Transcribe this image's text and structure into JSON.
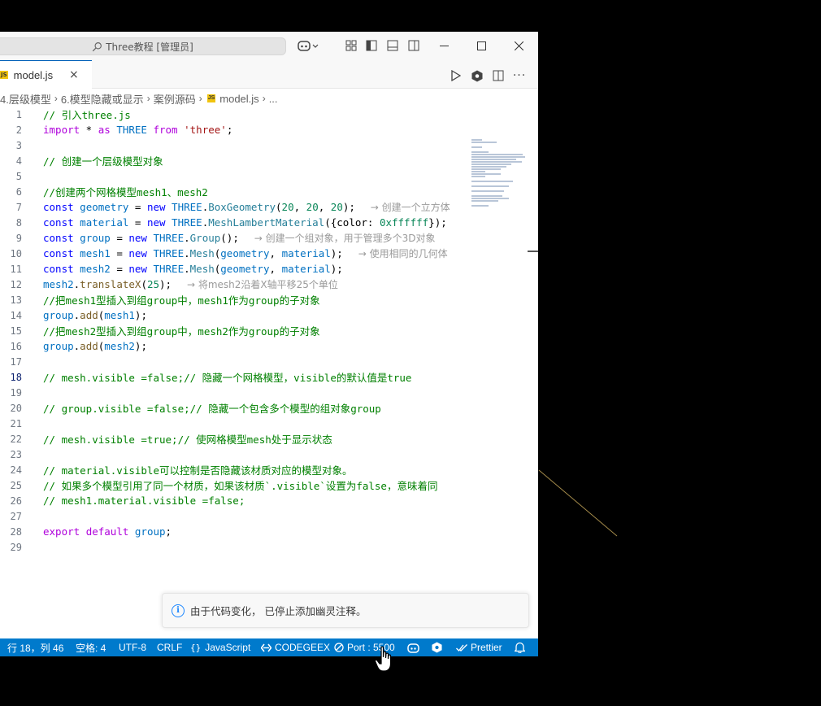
{
  "window": {
    "search_title": "Three教程 [管理员]"
  },
  "tab": {
    "badge": "JS",
    "label": "model.js",
    "close": "×"
  },
  "breadcrumb": {
    "items": [
      "4.层级模型",
      "6.模型隐藏或显示",
      "案例源码",
      "model.js",
      "..."
    ],
    "file_badge": "JS"
  },
  "editor": {
    "current_line": 18,
    "lines": [
      {
        "n": "1",
        "tokens": [
          {
            "t": "// 引入three.js",
            "c": "cmt"
          }
        ]
      },
      {
        "n": "2",
        "tokens": [
          {
            "t": "import",
            "c": "ctl"
          },
          {
            "t": " * ",
            "c": "plain"
          },
          {
            "t": "as",
            "c": "ctl"
          },
          {
            "t": " THREE ",
            "c": "var"
          },
          {
            "t": "from",
            "c": "ctl"
          },
          {
            "t": " ",
            "c": "plain"
          },
          {
            "t": "'three'",
            "c": "str"
          },
          {
            "t": ";",
            "c": "plain"
          }
        ]
      },
      {
        "n": "3",
        "tokens": []
      },
      {
        "n": "4",
        "tokens": [
          {
            "t": "// 创建一个层级模型对象",
            "c": "cmt"
          }
        ]
      },
      {
        "n": "5",
        "tokens": []
      },
      {
        "n": "6",
        "tokens": [
          {
            "t": "//创建两个网格模型mesh1、mesh2",
            "c": "cmt"
          }
        ]
      },
      {
        "n": "7",
        "tokens": [
          {
            "t": "const",
            "c": "kw"
          },
          {
            "t": " geometry",
            "c": "var"
          },
          {
            "t": " = ",
            "c": "plain"
          },
          {
            "t": "new",
            "c": "kw"
          },
          {
            "t": " THREE",
            "c": "var"
          },
          {
            "t": ".",
            "c": "plain"
          },
          {
            "t": "BoxGeometry",
            "c": "cls"
          },
          {
            "t": "(",
            "c": "plain"
          },
          {
            "t": "20",
            "c": "num"
          },
          {
            "t": ", ",
            "c": "plain"
          },
          {
            "t": "20",
            "c": "num"
          },
          {
            "t": ", ",
            "c": "plain"
          },
          {
            "t": "20",
            "c": "num"
          },
          {
            "t": ");  ",
            "c": "plain"
          },
          {
            "t": " → 创建一个立方体",
            "c": "ghost"
          }
        ]
      },
      {
        "n": "8",
        "tokens": [
          {
            "t": "const",
            "c": "kw"
          },
          {
            "t": " material",
            "c": "var"
          },
          {
            "t": " = ",
            "c": "plain"
          },
          {
            "t": "new",
            "c": "kw"
          },
          {
            "t": " THREE",
            "c": "var"
          },
          {
            "t": ".",
            "c": "plain"
          },
          {
            "t": "MeshLambertMaterial",
            "c": "cls"
          },
          {
            "t": "({color: ",
            "c": "plain"
          },
          {
            "t": "0xffffff",
            "c": "num"
          },
          {
            "t": "});",
            "c": "plain"
          }
        ]
      },
      {
        "n": "9",
        "tokens": [
          {
            "t": "const",
            "c": "kw"
          },
          {
            "t": " group",
            "c": "var"
          },
          {
            "t": " = ",
            "c": "plain"
          },
          {
            "t": "new",
            "c": "kw"
          },
          {
            "t": " THREE",
            "c": "var"
          },
          {
            "t": ".",
            "c": "plain"
          },
          {
            "t": "Group",
            "c": "cls"
          },
          {
            "t": "();  ",
            "c": "plain"
          },
          {
            "t": " → 创建一个组对象，用于管理多个3D对象",
            "c": "ghost"
          }
        ]
      },
      {
        "n": "10",
        "tokens": [
          {
            "t": "const",
            "c": "kw"
          },
          {
            "t": " mesh1",
            "c": "var"
          },
          {
            "t": " = ",
            "c": "plain"
          },
          {
            "t": "new",
            "c": "kw"
          },
          {
            "t": " THREE",
            "c": "var"
          },
          {
            "t": ".",
            "c": "plain"
          },
          {
            "t": "Mesh",
            "c": "cls"
          },
          {
            "t": "(",
            "c": "plain"
          },
          {
            "t": "geometry",
            "c": "var"
          },
          {
            "t": ", ",
            "c": "plain"
          },
          {
            "t": "material",
            "c": "var"
          },
          {
            "t": ");  ",
            "c": "plain"
          },
          {
            "t": " → 使用相同的几何体",
            "c": "ghost"
          }
        ]
      },
      {
        "n": "11",
        "tokens": [
          {
            "t": "const",
            "c": "kw"
          },
          {
            "t": " mesh2",
            "c": "var"
          },
          {
            "t": " = ",
            "c": "plain"
          },
          {
            "t": "new",
            "c": "kw"
          },
          {
            "t": " THREE",
            "c": "var"
          },
          {
            "t": ".",
            "c": "plain"
          },
          {
            "t": "Mesh",
            "c": "cls"
          },
          {
            "t": "(",
            "c": "plain"
          },
          {
            "t": "geometry",
            "c": "var"
          },
          {
            "t": ", ",
            "c": "plain"
          },
          {
            "t": "material",
            "c": "var"
          },
          {
            "t": ");",
            "c": "plain"
          }
        ]
      },
      {
        "n": "12",
        "tokens": [
          {
            "t": "mesh2",
            "c": "var"
          },
          {
            "t": ".",
            "c": "plain"
          },
          {
            "t": "translateX",
            "c": "fn"
          },
          {
            "t": "(",
            "c": "plain"
          },
          {
            "t": "25",
            "c": "num"
          },
          {
            "t": ");  ",
            "c": "plain"
          },
          {
            "t": " → 将mesh2沿着X轴平移25个单位",
            "c": "ghost"
          }
        ]
      },
      {
        "n": "13",
        "tokens": [
          {
            "t": "//把mesh1型插入到组group中，mesh1作为group的子对象",
            "c": "cmt"
          }
        ]
      },
      {
        "n": "14",
        "tokens": [
          {
            "t": "group",
            "c": "var"
          },
          {
            "t": ".",
            "c": "plain"
          },
          {
            "t": "add",
            "c": "fn"
          },
          {
            "t": "(",
            "c": "plain"
          },
          {
            "t": "mesh1",
            "c": "var"
          },
          {
            "t": ");",
            "c": "plain"
          }
        ]
      },
      {
        "n": "15",
        "tokens": [
          {
            "t": "//把mesh2型插入到组group中，mesh2作为group的子对象",
            "c": "cmt"
          }
        ]
      },
      {
        "n": "16",
        "tokens": [
          {
            "t": "group",
            "c": "var"
          },
          {
            "t": ".",
            "c": "plain"
          },
          {
            "t": "add",
            "c": "fn"
          },
          {
            "t": "(",
            "c": "plain"
          },
          {
            "t": "mesh2",
            "c": "var"
          },
          {
            "t": ");",
            "c": "plain"
          }
        ]
      },
      {
        "n": "17",
        "tokens": []
      },
      {
        "n": "18",
        "tokens": [
          {
            "t": "// mesh.visible =false;// 隐藏一个网格模型，visible的默认值是true",
            "c": "cmt"
          }
        ]
      },
      {
        "n": "19",
        "tokens": []
      },
      {
        "n": "20",
        "tokens": [
          {
            "t": "// group.visible =false;// 隐藏一个包含多个模型的组对象group",
            "c": "cmt"
          }
        ]
      },
      {
        "n": "21",
        "tokens": []
      },
      {
        "n": "22",
        "tokens": [
          {
            "t": "// mesh.visible =true;// 使网格模型mesh处于显示状态",
            "c": "cmt"
          }
        ]
      },
      {
        "n": "23",
        "tokens": []
      },
      {
        "n": "24",
        "tokens": [
          {
            "t": "// material.visible可以控制是否隐藏该材质对应的模型对象。",
            "c": "cmt"
          }
        ]
      },
      {
        "n": "25",
        "tokens": [
          {
            "t": "// 如果多个模型引用了同一个材质，如果该材质`.visible`设置为false，意味着同",
            "c": "cmt"
          }
        ]
      },
      {
        "n": "26",
        "tokens": [
          {
            "t": "// mesh1.material.visible =false;",
            "c": "cmt"
          }
        ]
      },
      {
        "n": "27",
        "tokens": []
      },
      {
        "n": "28",
        "tokens": [
          {
            "t": "export",
            "c": "ctl"
          },
          {
            "t": " ",
            "c": "plain"
          },
          {
            "t": "default",
            "c": "ctl"
          },
          {
            "t": " ",
            "c": "plain"
          },
          {
            "t": "group",
            "c": "var"
          },
          {
            "t": ";",
            "c": "plain"
          }
        ]
      },
      {
        "n": "29",
        "tokens": []
      }
    ]
  },
  "notification": {
    "icon": "info-icon",
    "icon_glyph": "i",
    "text": "由于代码变化， 已停止添加幽灵注释。"
  },
  "statusbar": {
    "position": "行 18，列 46",
    "spaces": "空格: 4",
    "encoding": "UTF-8",
    "eol": "CRLF",
    "language_braces": "{}",
    "language": "JavaScript",
    "codegeex": "CODEGEEX",
    "port": "Port : 5500",
    "prettier": "Prettier"
  },
  "colors": {
    "statusbar_bg": "#007acc",
    "tab_accent": "#005fb8",
    "js_badge": "#f1c40f"
  }
}
